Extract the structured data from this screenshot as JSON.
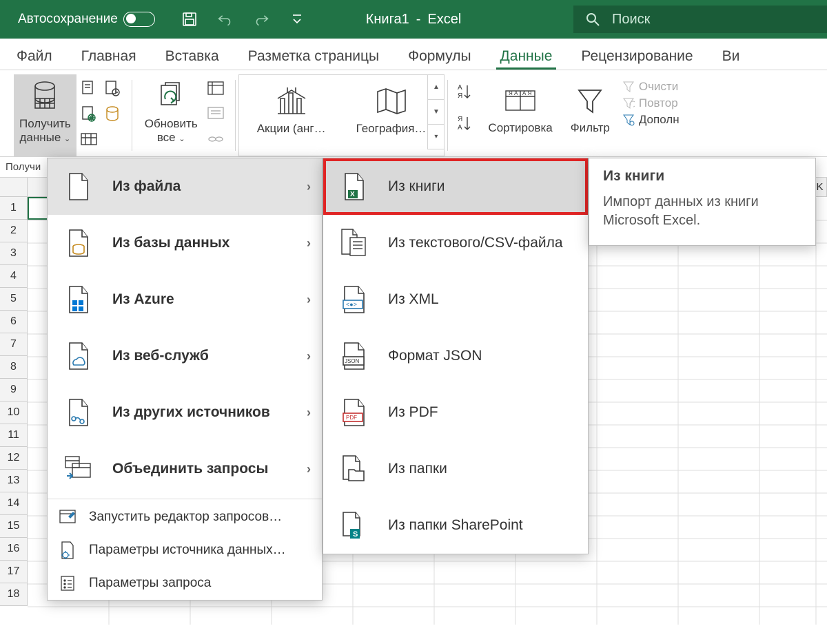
{
  "titlebar": {
    "autosave": "Автосохранение",
    "doc_name": "Книга1",
    "separator": "-",
    "app_name": "Excel",
    "search_placeholder": "Поиск"
  },
  "tabs": {
    "file": "Файл",
    "home": "Главная",
    "insert": "Вставка",
    "pagelayout": "Разметка страницы",
    "formulas": "Формулы",
    "data": "Данные",
    "review": "Рецензирование",
    "view": "Ви"
  },
  "ribbon": {
    "get_data_1": "Получить",
    "get_data_2": "данные",
    "refresh_1": "Обновить",
    "refresh_2": "все",
    "stocks": "Акции (анг…",
    "geography": "География…",
    "sort": "Сортировка",
    "filter": "Фильтр",
    "clear": "Очисти",
    "reapply": "Повтор",
    "advanced": "Дополн"
  },
  "namebox_label": "Получи",
  "col_K": "K",
  "menu1": {
    "from_file": "Из файла",
    "from_db": "Из базы данных",
    "from_azure": "Из Azure",
    "from_web": "Из веб-служб",
    "from_other": "Из других источников",
    "combine": "Объединить запросы",
    "launch_editor": "Запустить редактор запросов…",
    "source_params": "Параметры источника данных…",
    "query_params": "Параметры запроса"
  },
  "menu2": {
    "from_book": "Из книги",
    "from_csv": "Из текстового/CSV-файла",
    "from_xml": "Из XML",
    "from_json": "Формат JSON",
    "from_pdf": "Из PDF",
    "from_folder": "Из папки",
    "from_sharepoint": "Из папки SharePoint"
  },
  "tooltip": {
    "title": "Из книги",
    "body": "Импорт данных из книги Microsoft Excel."
  },
  "rows": [
    "1",
    "2",
    "3",
    "4",
    "5",
    "6",
    "7",
    "8",
    "9",
    "10",
    "11",
    "12",
    "13",
    "14",
    "15",
    "16",
    "17",
    "18"
  ]
}
